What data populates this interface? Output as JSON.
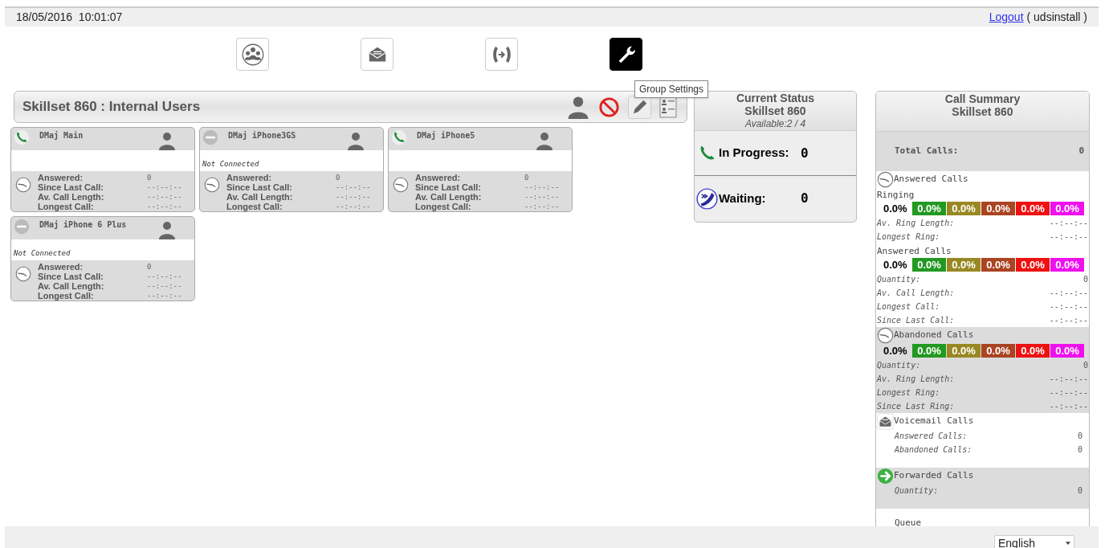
{
  "header": {
    "datetime": "18/05/2016  10:01:07",
    "logout": "Logout",
    "user": "( udsinstall )"
  },
  "toolbar": [
    {
      "kind": "group",
      "selected": false
    },
    {
      "kind": "voicemail",
      "selected": false
    },
    {
      "kind": "forward",
      "selected": false
    },
    {
      "kind": "settings",
      "selected": true
    }
  ],
  "tooltip": "Group Settings",
  "skillset": {
    "title": "Skillset 860 : Internal Users"
  },
  "users": [
    {
      "name": "DMaj Main",
      "kind": "connected",
      "stats": [
        {
          "label": "Answered:",
          "value": "0"
        },
        {
          "label": "Since Last Call:",
          "value": "--:--:--"
        },
        {
          "label": "Av. Call Length:",
          "value": "--:--:--"
        },
        {
          "label": "Longest Call:",
          "value": "--:--:--"
        }
      ]
    },
    {
      "name": "DMaj iPhone3GS",
      "kind": "disconnected",
      "status": "Not Connected",
      "stats": [
        {
          "label": "Answered:",
          "value": "0"
        },
        {
          "label": "Since Last Call:",
          "value": "--:--:--"
        },
        {
          "label": "Av. Call Length:",
          "value": "--:--:--"
        },
        {
          "label": "Longest Call:",
          "value": "--:--:--"
        }
      ]
    },
    {
      "name": "DMaj iPhone5",
      "kind": "connected",
      "stats": [
        {
          "label": "Answered:",
          "value": "0"
        },
        {
          "label": "Since Last Call:",
          "value": "--:--:--"
        },
        {
          "label": "Av. Call Length:",
          "value": "--:--:--"
        },
        {
          "label": "Longest Call:",
          "value": "--:--:--"
        }
      ]
    },
    {
      "name": "DMaj iPhone 6 Plus",
      "kind": "disconnected",
      "status": "Not Connected",
      "stats": [
        {
          "label": "Answered:",
          "value": "0"
        },
        {
          "label": "Since Last Call:",
          "value": "--:--:--"
        },
        {
          "label": "Av. Call Length:",
          "value": "--:--:--"
        },
        {
          "label": "Longest Call:",
          "value": "--:--:--"
        }
      ]
    }
  ],
  "current_status": {
    "title": "Current Status",
    "subtitle": "Skillset 860",
    "available": "Available:2 / 4",
    "rows": [
      {
        "kind": "in_progress",
        "label": "In Progress:",
        "value": "0"
      },
      {
        "kind": "waiting",
        "label": "Waiting:",
        "value": "0"
      }
    ]
  },
  "call_summary": {
    "title": "Call Summary",
    "subtitle": "Skillset 860",
    "total": {
      "label": "Total Calls:",
      "value": "0"
    },
    "sections": [
      {
        "kind": "clock",
        "shaded": false,
        "title": "Answered Calls",
        "groups": [
          {
            "title": "Ringing",
            "percents": [
              {
                "text": "0.0%"
              },
              {
                "text": "0.0%",
                "color": "#229922"
              },
              {
                "text": "0.0%",
                "color": "#998822"
              },
              {
                "text": "0.0%",
                "color": "#aa4422"
              },
              {
                "text": "0.0%",
                "color": "#ee1111"
              },
              {
                "text": "0.0%",
                "color": "#ee11ee"
              }
            ],
            "rows": [
              {
                "label": "Av. Ring Length:",
                "value": "--:--:--"
              },
              {
                "label": "Longest Ring:",
                "value": "--:--:--"
              }
            ]
          },
          {
            "title": "Answered Calls",
            "percents": [
              {
                "text": "0.0%"
              },
              {
                "text": "0.0%",
                "color": "#229922"
              },
              {
                "text": "0.0%",
                "color": "#998822"
              },
              {
                "text": "0.0%",
                "color": "#aa4422"
              },
              {
                "text": "0.0%",
                "color": "#ee1111"
              },
              {
                "text": "0.0%",
                "color": "#ee11ee"
              }
            ],
            "rows": [
              {
                "label": "Quantity:",
                "value": "0"
              },
              {
                "label": "Av. Call Length:",
                "value": "--:--:--"
              },
              {
                "label": "Longest Call:",
                "value": "--:--:--"
              },
              {
                "label": "Since Last Call:",
                "value": "--:--:--"
              }
            ]
          }
        ]
      },
      {
        "kind": "clock",
        "shaded": true,
        "title": "Abandoned Calls",
        "groups": [
          {
            "percents": [
              {
                "text": "0.0%"
              },
              {
                "text": "0.0%",
                "color": "#229922"
              },
              {
                "text": "0.0%",
                "color": "#998822"
              },
              {
                "text": "0.0%",
                "color": "#aa4422"
              },
              {
                "text": "0.0%",
                "color": "#ee1111"
              },
              {
                "text": "0.0%",
                "color": "#ee11ee"
              }
            ],
            "rows": [
              {
                "label": "Quantity:",
                "value": "0"
              },
              {
                "label": "Av. Ring Length:",
                "value": "--:--:--"
              },
              {
                "label": "Longest Ring:",
                "value": "--:--:--"
              },
              {
                "label": "Since Last Ring:",
                "value": "--:--:--"
              }
            ]
          }
        ]
      },
      {
        "kind": "voicemail",
        "shaded": false,
        "title": "Voicemail Calls",
        "groups": [
          {
            "rows": [
              {
                "label": "Answered Calls:",
                "value": "0"
              },
              {
                "label": "Abandoned Calls:",
                "value": "0"
              }
            ]
          }
        ]
      },
      {
        "kind": "forward",
        "shaded": true,
        "title": "Forwarded Calls",
        "groups": [
          {
            "rows": [
              {
                "label": "Quantity:",
                "value": "0"
              }
            ]
          }
        ]
      },
      {
        "kind": "none",
        "shaded": false,
        "title": "Queue"
      }
    ]
  },
  "footer": {
    "language": "English"
  }
}
